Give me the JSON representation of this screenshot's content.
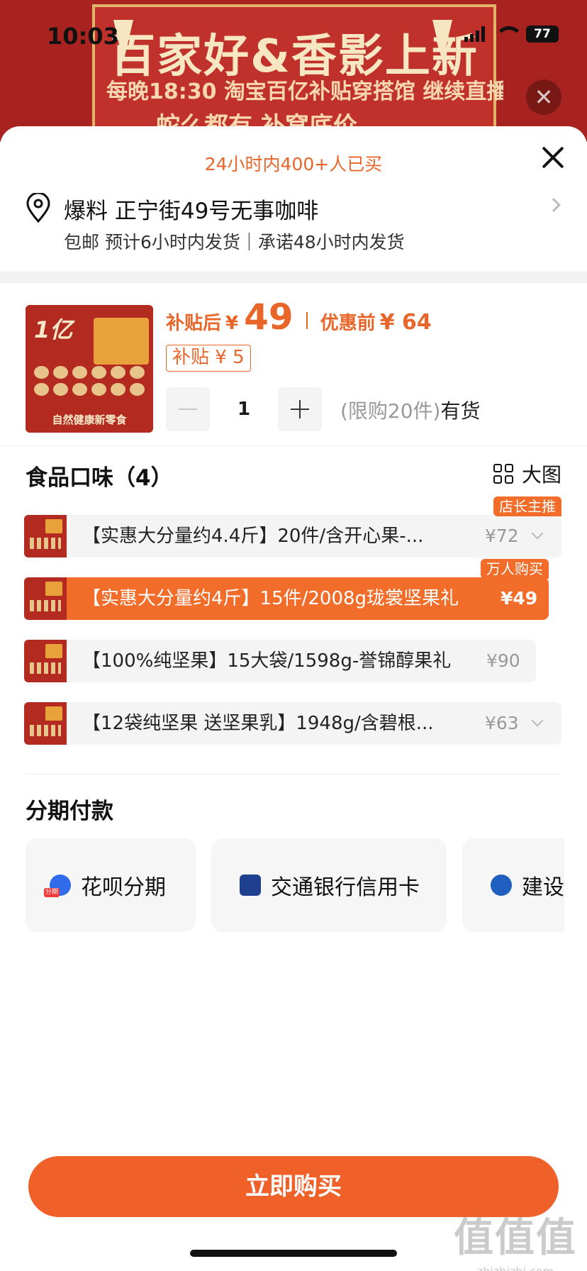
{
  "status_bar": {
    "time": "10:03",
    "battery": "77"
  },
  "background": {
    "title": "百家好&香影上新",
    "subtitle": "每晚18:30 淘宝百亿补贴穿搭馆 继续直播...",
    "subtitle2": "蛇么都有 补窝底价"
  },
  "sheet": {
    "buyers_notice": "24小时内400+人已买",
    "address": {
      "title": "爆料 正宁街49号无事咖啡",
      "shipping": "包邮 预计6小时内发货｜承诺48小时内发货"
    },
    "product": {
      "thumb_text": "1亿",
      "thumb_footer": "自然健康新零食",
      "after_subsidy_label": "补贴后",
      "currency": "¥",
      "price": "49",
      "before_label": "优惠前",
      "original_price": "¥ 64",
      "subsidy_tag": "补贴 ¥ 5",
      "quantity": "1",
      "limit": "(限购20件)",
      "stock": "有货"
    },
    "flavor": {
      "title": "食品口味（4）",
      "big_view": "大图",
      "options": [
        {
          "label": "【实惠大分量约4.4斤】20件/含开心果-...",
          "price": "¥72",
          "tag": "店长主推"
        },
        {
          "label": "【实惠大分量约4斤】15件/2008g珑裳坚果礼",
          "price": "¥49",
          "tag": "万人购买"
        },
        {
          "label": "【100%纯坚果】15大袋/1598g-誉锦醇果礼",
          "price": "¥90",
          "tag": ""
        },
        {
          "label": "【12袋纯坚果 送坚果乳】1948g/含碧根...",
          "price": "¥63",
          "tag": ""
        }
      ]
    },
    "installment": {
      "title": "分期付款",
      "options": [
        {
          "label": "花呗分期",
          "icon": "huabei-icon",
          "badge": "分期"
        },
        {
          "label": "交通银行信用卡",
          "icon": "bocom-icon"
        },
        {
          "label": "建设",
          "icon": "ccb-icon"
        }
      ]
    },
    "buy_button": "立即购买"
  },
  "watermark": {
    "main": "值值值",
    "url": "zhizhizhi.com"
  },
  "colors": {
    "accent": "#ef6128",
    "price": "#e8662a",
    "banner": "#a8231f"
  }
}
